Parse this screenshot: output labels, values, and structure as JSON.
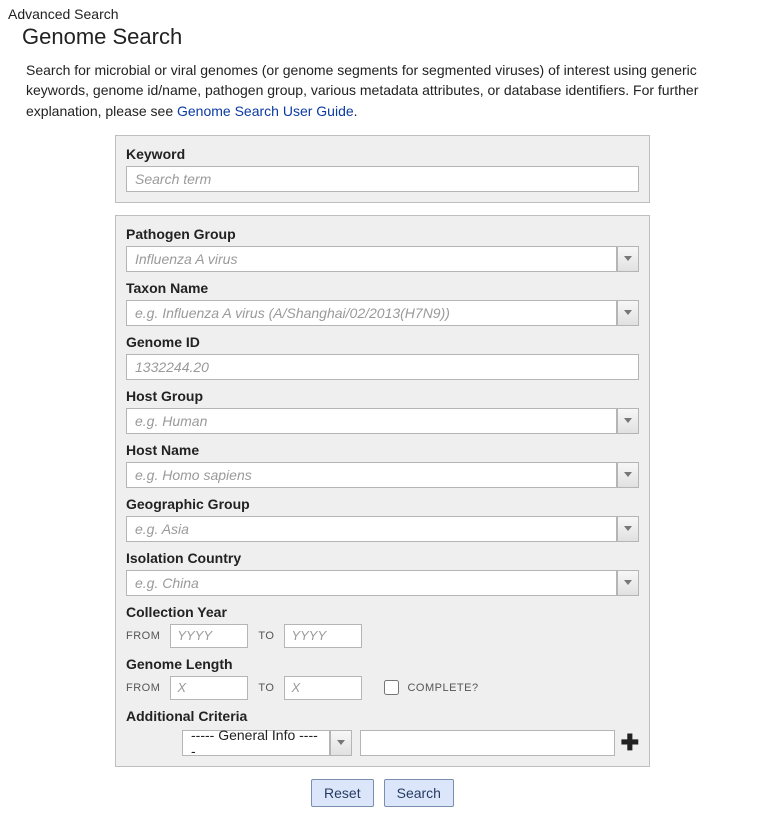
{
  "header": {
    "breadcrumb": "Advanced Search",
    "title": "Genome Search"
  },
  "intro": {
    "text": "Search for microbial or viral genomes (or genome segments for segmented viruses) of interest using generic keywords, genome id/name, pathogen group, various metadata attributes, or database identifiers. For further explanation, please see ",
    "link_text": "Genome Search User Guide",
    "suffix": "."
  },
  "keyword": {
    "label": "Keyword",
    "placeholder": "Search term"
  },
  "fields": {
    "pathogen_group": {
      "label": "Pathogen Group",
      "placeholder": "Influenza A virus"
    },
    "taxon_name": {
      "label": "Taxon Name",
      "placeholder": "e.g. Influenza A virus (A/Shanghai/02/2013(H7N9))"
    },
    "genome_id": {
      "label": "Genome ID",
      "placeholder": "1332244.20"
    },
    "host_group": {
      "label": "Host Group",
      "placeholder": "e.g. Human"
    },
    "host_name": {
      "label": "Host Name",
      "placeholder": "e.g. Homo sapiens"
    },
    "geo_group": {
      "label": "Geographic Group",
      "placeholder": "e.g. Asia"
    },
    "isolation_country": {
      "label": "Isolation Country",
      "placeholder": "e.g. China"
    },
    "collection_year": {
      "label": "Collection Year",
      "from_label": "FROM",
      "to_label": "TO",
      "placeholder": "YYYY"
    },
    "genome_length": {
      "label": "Genome Length",
      "from_label": "FROM",
      "to_label": "TO",
      "placeholder": "X",
      "complete_label": "COMPLETE?"
    },
    "additional": {
      "label": "Additional Criteria",
      "select_default": "----- General Info -----"
    }
  },
  "actions": {
    "reset": "Reset",
    "search": "Search"
  }
}
